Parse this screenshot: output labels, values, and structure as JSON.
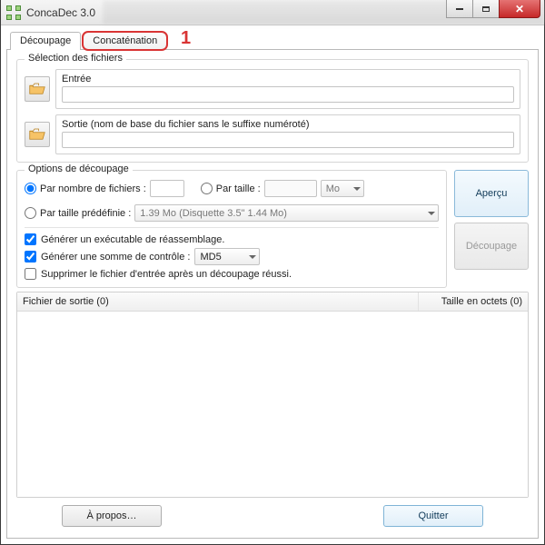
{
  "window": {
    "title": "ConcaDec 3.0"
  },
  "annotation": {
    "one": "1"
  },
  "tabs": {
    "decoupage": "Découpage",
    "concat": "Concaténation"
  },
  "files": {
    "legend": "Sélection des fichiers",
    "input_label": "Entrée",
    "output_label": "Sortie (nom de base du fichier sans le suffixe numéroté)"
  },
  "options": {
    "legend": "Options de découpage",
    "by_count": "Par nombre de fichiers :",
    "by_size": "Par taille :",
    "size_unit": "Mo",
    "by_preset": "Par taille prédéfinie :",
    "preset_value": "1.39 Mo (Disquette 3.5\" 1.44 Mo)",
    "gen_exec": "Générer un exécutable de réassemblage.",
    "gen_checksum": "Générer une somme de contrôle :",
    "checksum_alg": "MD5",
    "delete_after": "Supprimer le fichier d'entrée après un découpage réussi."
  },
  "bigbuttons": {
    "preview": "Aperçu",
    "split": "Découpage"
  },
  "list": {
    "col_file": "Fichier de sortie (0)",
    "col_size": "Taille en octets (0)"
  },
  "footer": {
    "about": "À propos…",
    "quit": "Quitter"
  }
}
